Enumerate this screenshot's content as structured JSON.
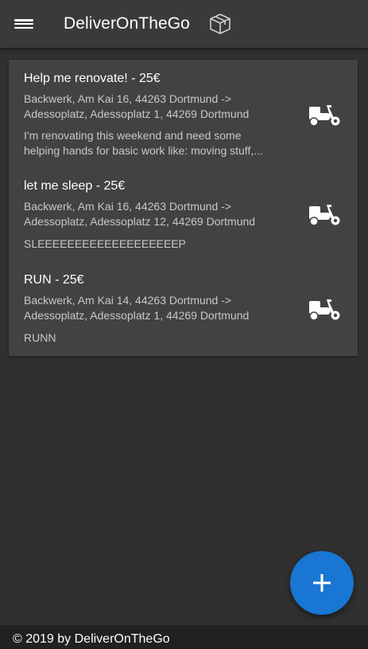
{
  "header": {
    "title": "DeliverOnTheGo",
    "menu_icon": "menu-icon",
    "logo_icon": "package-box-icon"
  },
  "deliveries": [
    {
      "title": "Help me renovate! - 25€",
      "route_line1": "Backwerk, Am Kai 16, 44263 Dortmund ->",
      "route_line2": "Adessoplatz, Adessoplatz 1, 44269 Dortmund",
      "description_line1": "I'm renovating this weekend and need some",
      "description_line2": "helping hands for basic work like: moving stuff,...",
      "icon": "scooter-icon"
    },
    {
      "title": "let me sleep - 25€",
      "route_line1": "Backwerk, Am Kai 16, 44263 Dortmund ->",
      "route_line2": "Adessoplatz, Adessoplatz 12, 44269 Dortmund",
      "description_line1": "SLEEEEEEEEEEEEEEEEEEEP",
      "icon": "scooter-icon"
    },
    {
      "title": "RUN - 25€",
      "route_line1": "Backwerk, Am Kai 14, 44263 Dortmund ->",
      "route_line2": "Adessoplatz, Adessoplatz 1, 44269 Dortmund",
      "description_line1": "RUNN",
      "icon": "scooter-icon"
    }
  ],
  "fab": {
    "icon": "plus-icon",
    "color": "#1976d2"
  },
  "footer": {
    "text": "© 2019 by DeliverOnTheGo"
  },
  "theme": {
    "background": "#303030",
    "toolbar": "#3a3a3a",
    "card": "#424242",
    "footer": "#212121",
    "secondary_text": "#c8c8c8"
  }
}
